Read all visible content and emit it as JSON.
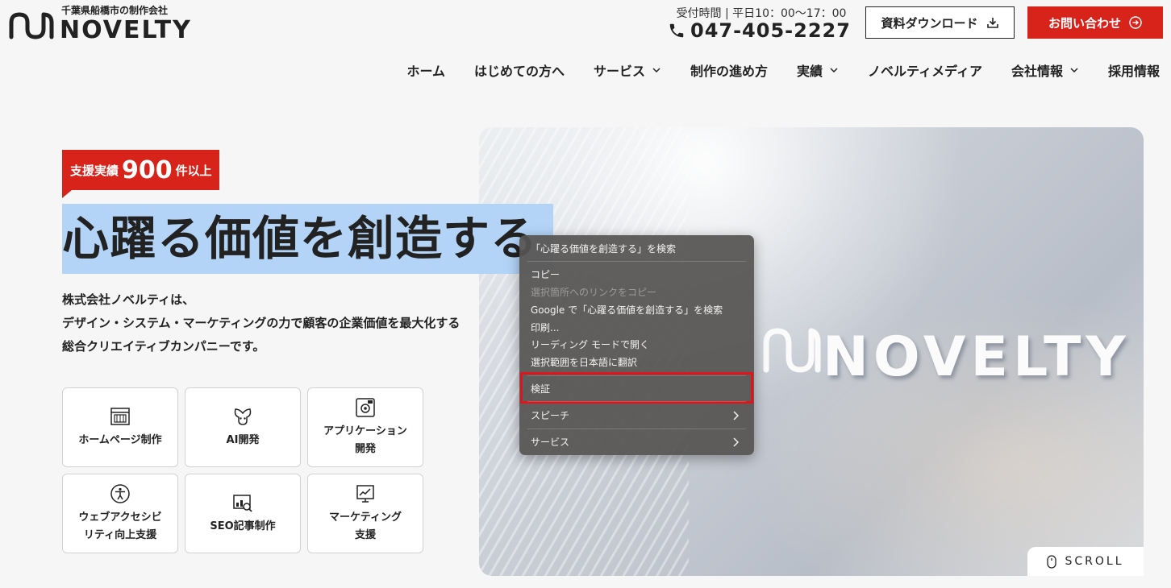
{
  "header": {
    "tagline": "千葉県船橋市の制作会社",
    "logo_text": "NOVELTY",
    "hours": "受付時間 | 平日10：00〜17：00",
    "phone": "047-405-2227",
    "download_button": "資料ダウンロード",
    "contact_button": "お問い合わせ"
  },
  "nav": {
    "items": [
      {
        "label": "ホーム",
        "has_dropdown": false
      },
      {
        "label": "はじめての方へ",
        "has_dropdown": false
      },
      {
        "label": "サービス",
        "has_dropdown": true
      },
      {
        "label": "制作の進め方",
        "has_dropdown": false
      },
      {
        "label": "実績",
        "has_dropdown": true
      },
      {
        "label": "ノベルティメディア",
        "has_dropdown": false
      },
      {
        "label": "会社情報",
        "has_dropdown": true
      },
      {
        "label": "採用情報",
        "has_dropdown": false
      }
    ]
  },
  "hero": {
    "badge_pre": "支援実績",
    "badge_number": "900",
    "badge_post": "件以上",
    "headline": "心躍る価値を創造する",
    "intro_lines": [
      "株式会社ノベルティは、",
      "デザイン・システム・マーケティングの力で顧客の企業価値を最大化する",
      "総合クリエイティブカンパニーです。"
    ],
    "image_logo_text": "NOVELTY",
    "scroll_label": "SCROLL"
  },
  "services": [
    {
      "label": "ホームページ制作",
      "icon": "webpage-icon"
    },
    {
      "label": "AI開発",
      "icon": "ai-robot-icon"
    },
    {
      "label": "アプリケーション\n開発",
      "icon": "app-gear-icon"
    },
    {
      "label": "ウェブアクセシビ\nリティ向上支援",
      "icon": "accessibility-icon"
    },
    {
      "label": "SEO記事制作",
      "icon": "seo-chart-icon"
    },
    {
      "label": "マーケティング\n支援",
      "icon": "marketing-icon"
    }
  ],
  "context_menu": {
    "search_selection": "「心躍る価値を創造する」を検索",
    "copy": "コピー",
    "copy_link": "選択箇所へのリンクをコピー",
    "google_search": "Google で「心躍る価値を創造する」を検索",
    "print": "印刷...",
    "reading_mode": "リーディング モードで開く",
    "translate": "選択範囲を日本語に翻訳",
    "inspect": "検証",
    "speech": "スピーチ",
    "services": "サービス"
  },
  "colors": {
    "brand_red": "#d7231a",
    "selection_blue": "#b3d4f7",
    "highlight_red": "#e0141a"
  }
}
